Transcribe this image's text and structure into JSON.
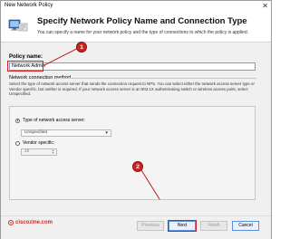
{
  "window": {
    "title": "New Network Policy",
    "close_glyph": "✕"
  },
  "header": {
    "title": "Specify Network Policy Name and Connection Type",
    "subtitle": "You can specify a name for your network policy and the type of connections to which the policy is applied."
  },
  "policy_name": {
    "label": "Policy name:",
    "value": "Network Admin"
  },
  "connection_method": {
    "label": "Network connection method",
    "description": "Select the type of network access server that sends the connection request to NPS. You can select either the network access server type or Vendor specific, but neither is required. If your network access server is an 802.1X authenticating switch or wireless access point, select Unspecified."
  },
  "options": {
    "type_label": "Type of network access server:",
    "type_checked": true,
    "type_value": "Unspecified",
    "vendor_label": "Vendor specific:",
    "vendor_checked": false,
    "vendor_value": "10"
  },
  "buttons": {
    "previous": "Previous",
    "next": "Next",
    "finish": "Finish",
    "cancel": "Cancel"
  },
  "watermark": {
    "copyright_glyph": "c",
    "text": "ciscozine.com"
  },
  "callouts": {
    "one": "1",
    "two": "2"
  },
  "colors": {
    "callout": "#c92525",
    "focus_border": "#5c8fe0"
  },
  "icons": {
    "header": "network-policy-icon",
    "dropdown": "chevron-down-icon",
    "spinner": "spinner-arrows-icon"
  }
}
